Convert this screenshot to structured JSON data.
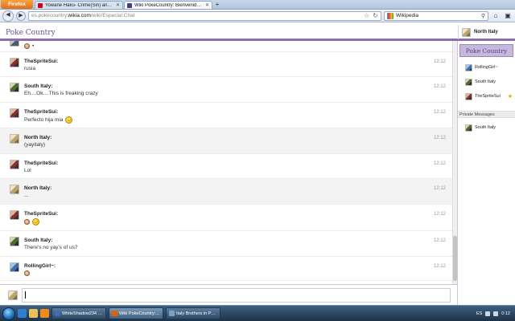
{
  "browser": {
    "app_button": "Firefox",
    "tabs": [
      {
        "label": "Yowane Haku- Crime(Sin) and Punis...",
        "favicon_color": "#d0021b",
        "active": false
      },
      {
        "label": "Wiki PokeCountry: Bienvenido al chat...",
        "favicon_color": "#4a3b7a",
        "active": true
      }
    ],
    "new_tab": "+",
    "url_prefix": "es.pokecountry.",
    "url_domain": "wikia.com",
    "url_path": "/wiki/Especial:Chat",
    "search_engine": "Wikipedia",
    "icons": [
      "back-icon",
      "forward-icon",
      "reload-icon",
      "stop-icon",
      "star-icon",
      "search-icon",
      "home-icon",
      "addon-icon"
    ]
  },
  "chat": {
    "wiki_name": "Poke Country",
    "current_user": "North Italy",
    "accent": "#8a6fa8",
    "messages": [
      {
        "user": "",
        "text": "",
        "time": "",
        "avatar": "a-top",
        "emotes": [
          "face",
          "dot"
        ],
        "alt": false,
        "partial": true
      },
      {
        "user": "TheSpriteSui:",
        "text": "rusia",
        "time": "12:12",
        "avatar": "a-sprite",
        "emotes": [],
        "alt": false
      },
      {
        "user": "South Italy:",
        "text": "Eh....Ok....This is freaking crazy",
        "time": "12:12",
        "avatar": "a-south",
        "emotes": [],
        "alt": false
      },
      {
        "user": "TheSpriteSui:",
        "text": "Perfecto hija mia",
        "time": "12:12",
        "avatar": "a-sprite",
        "emotes": [
          "smile"
        ],
        "alt": false
      },
      {
        "user": "North Italy:",
        "text": "(yayitaly)",
        "time": "12:12",
        "avatar": "a-north",
        "emotes": [],
        "alt": true
      },
      {
        "user": "TheSpriteSui:",
        "text": "Lol",
        "time": "12:12",
        "avatar": "a-sprite",
        "emotes": [],
        "alt": false
      },
      {
        "user": "North Italy:",
        "text": "...",
        "time": "12:12",
        "avatar": "a-north",
        "emotes": [],
        "alt": true
      },
      {
        "user": "TheSpriteSui:",
        "text": "",
        "time": "12:12",
        "avatar": "a-sprite",
        "emotes": [
          "face",
          "smile"
        ],
        "alt": false
      },
      {
        "user": "South Italy:",
        "text": "There's no yay's of us?",
        "time": "12:12",
        "avatar": "a-south",
        "emotes": [],
        "alt": false
      },
      {
        "user": "RollingGirl~:",
        "text": "",
        "time": "12:12",
        "avatar": "a-rolling",
        "emotes": [
          "face"
        ],
        "alt": false
      }
    ],
    "sidebar": {
      "wiki_badge": "Poke Country",
      "users": [
        {
          "name": "RollingGirl~",
          "avatar": "a-rolling",
          "mod": false
        },
        {
          "name": "South Italy",
          "avatar": "a-south",
          "mod": false
        },
        {
          "name": "TheSpriteSui",
          "avatar": "a-sprite",
          "mod": true
        }
      ],
      "pm_header": "Private Messages",
      "pm_users": [
        {
          "name": "South Italy",
          "avatar": "a-south"
        }
      ]
    },
    "input_value": ""
  },
  "taskbar": {
    "tasks": [
      {
        "label": "WhiteShadow234 o...",
        "icon_color": "#3b6fb6",
        "active": false
      },
      {
        "label": "Wiki PokeCountry:...",
        "icon_color": "#e66000",
        "active": true
      },
      {
        "label": "Italy Brothers in PC...",
        "icon_color": "#7aa0c4",
        "active": false
      }
    ],
    "language": "ES",
    "clock": "0:12"
  }
}
